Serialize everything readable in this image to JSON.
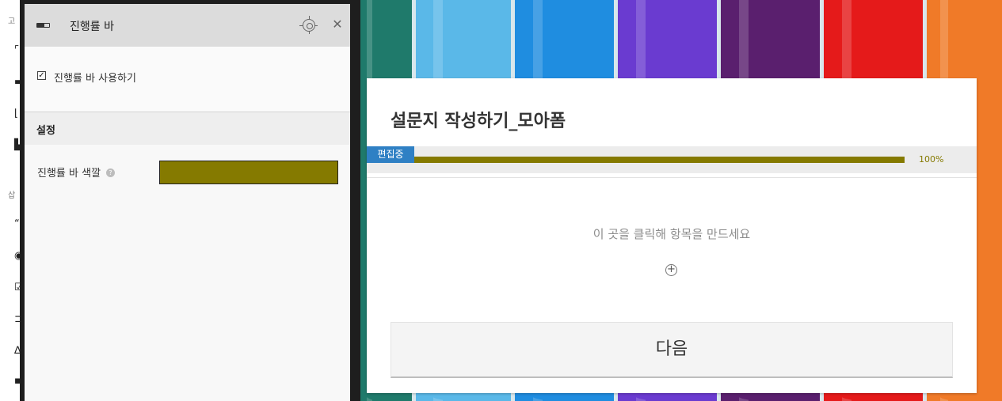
{
  "panel": {
    "title": "진행률 바",
    "use_label": "진행률 바 사용하기",
    "use_checked_mark": "✓",
    "section_label": "설정",
    "color_label": "진행률 바 색깔",
    "help_glyph": "?",
    "color_value": "#857a00",
    "close_glyph": "✕"
  },
  "under": {
    "label_top": "고",
    "label_insert": "삽"
  },
  "form": {
    "title": "설문지 작성하기_모아폼",
    "edit_badge": "편집중",
    "progress_fraction": 1.0,
    "progress_text": "100%",
    "progress_color": "#857a00",
    "placeholder": "이 곳을 클릭해 항목을 만드세요",
    "add_glyph": "+",
    "next_label": "다음"
  },
  "background": {
    "crayon_colors": [
      "#1f7a6b",
      "#5ab8e8",
      "#1f8de0",
      "#6a3bd0",
      "#5a1f6e",
      "#e51a1a",
      "#f07a28"
    ]
  }
}
